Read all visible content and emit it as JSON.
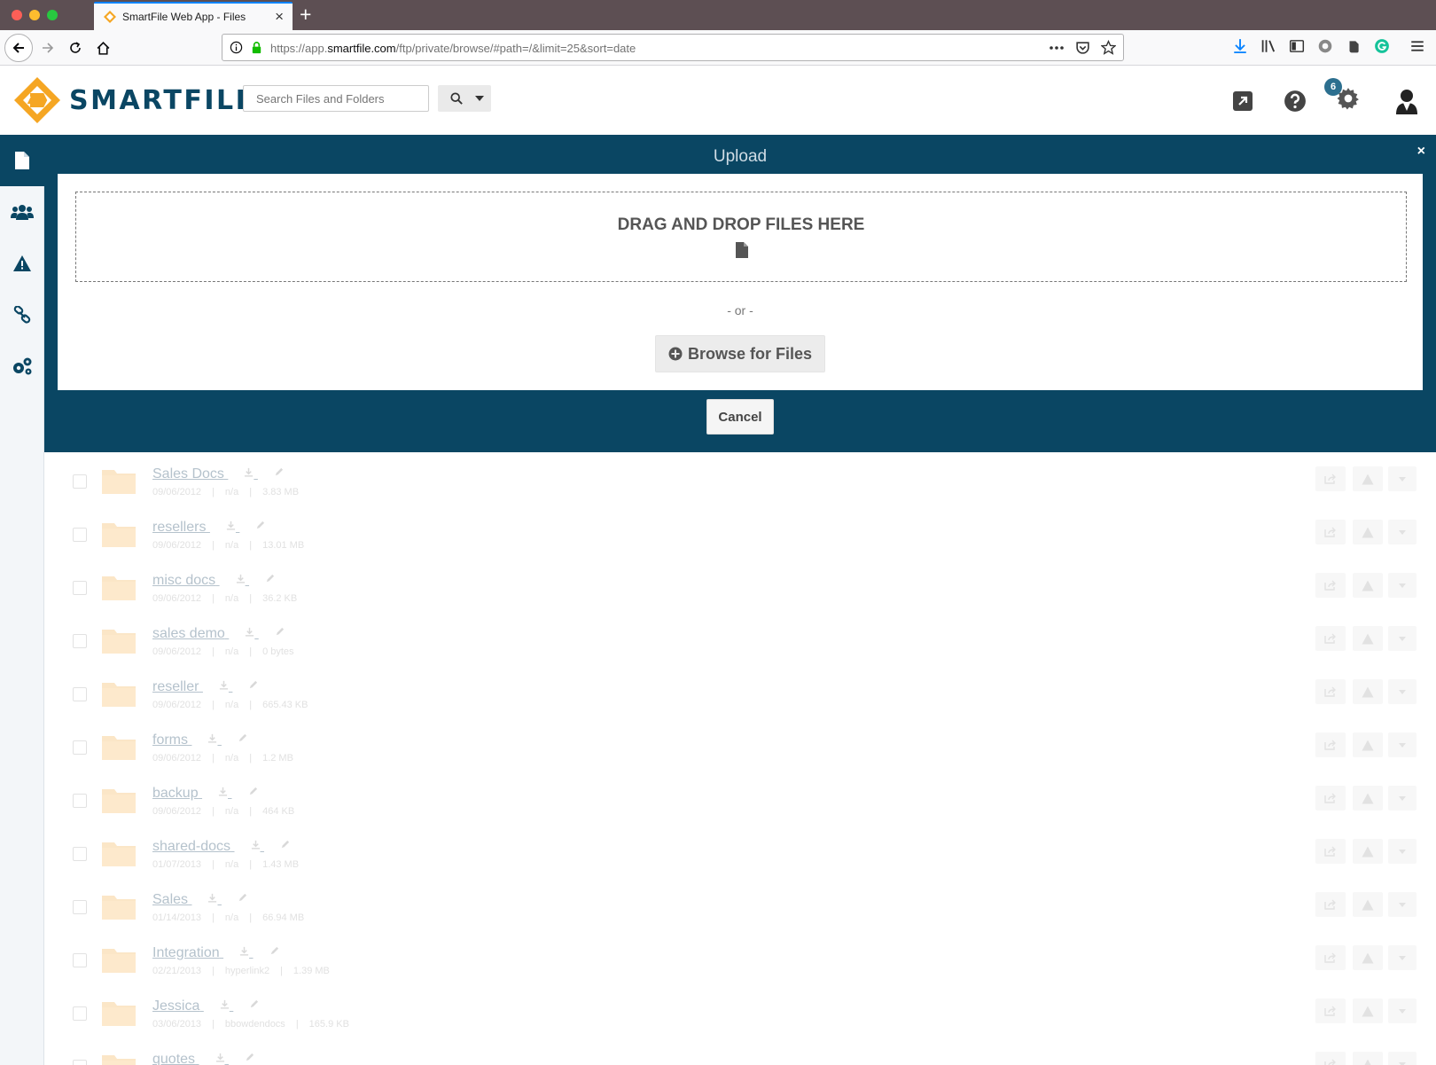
{
  "browser": {
    "tab_title": "SmartFile Web App - Files",
    "url_prefix": "https://app.",
    "url_host": "smartfile.com",
    "url_path": "/ftp/private/browse/#path=/&limit=25&sort=date"
  },
  "app": {
    "logo_text": "SMARTFILE",
    "search_placeholder": "Search Files and Folders",
    "notification_count": "6",
    "brand_color": "#0a4663",
    "accent_color": "#f5a623"
  },
  "sidebar": {
    "items": [
      {
        "icon": "file-icon",
        "active": true
      },
      {
        "icon": "users-icon",
        "active": false
      },
      {
        "icon": "warning-icon",
        "active": false
      },
      {
        "icon": "link-icon",
        "active": false
      },
      {
        "icon": "cogs-icon",
        "active": false
      }
    ]
  },
  "upload": {
    "title": "Upload",
    "close": "×",
    "dropzone_text": "DRAG AND DROP FILES HERE",
    "or_text": "- or -",
    "browse_label": "Browse for Files",
    "cancel_label": "Cancel"
  },
  "files": [
    {
      "name": "Sales Docs",
      "date": "09/06/2012",
      "owner": "n/a",
      "size": "3.83 MB"
    },
    {
      "name": "resellers",
      "date": "09/06/2012",
      "owner": "n/a",
      "size": "13.01 MB"
    },
    {
      "name": "misc docs",
      "date": "09/06/2012",
      "owner": "n/a",
      "size": "36.2 KB"
    },
    {
      "name": "sales demo",
      "date": "09/06/2012",
      "owner": "n/a",
      "size": "0 bytes"
    },
    {
      "name": "reseller",
      "date": "09/06/2012",
      "owner": "n/a",
      "size": "665.43 KB"
    },
    {
      "name": "forms",
      "date": "09/06/2012",
      "owner": "n/a",
      "size": "1.2 MB"
    },
    {
      "name": "backup",
      "date": "09/06/2012",
      "owner": "n/a",
      "size": "464 KB"
    },
    {
      "name": "shared-docs",
      "date": "01/07/2013",
      "owner": "n/a",
      "size": "1.43 MB"
    },
    {
      "name": "Sales",
      "date": "01/14/2013",
      "owner": "n/a",
      "size": "66.94 MB"
    },
    {
      "name": "Integration",
      "date": "02/21/2013",
      "owner": "hyperlink2",
      "size": "1.39 MB"
    },
    {
      "name": "Jessica",
      "date": "03/06/2013",
      "owner": "bbowdendocs",
      "size": "165.9 KB"
    },
    {
      "name": "quotes",
      "date": "",
      "owner": "",
      "size": ""
    }
  ]
}
